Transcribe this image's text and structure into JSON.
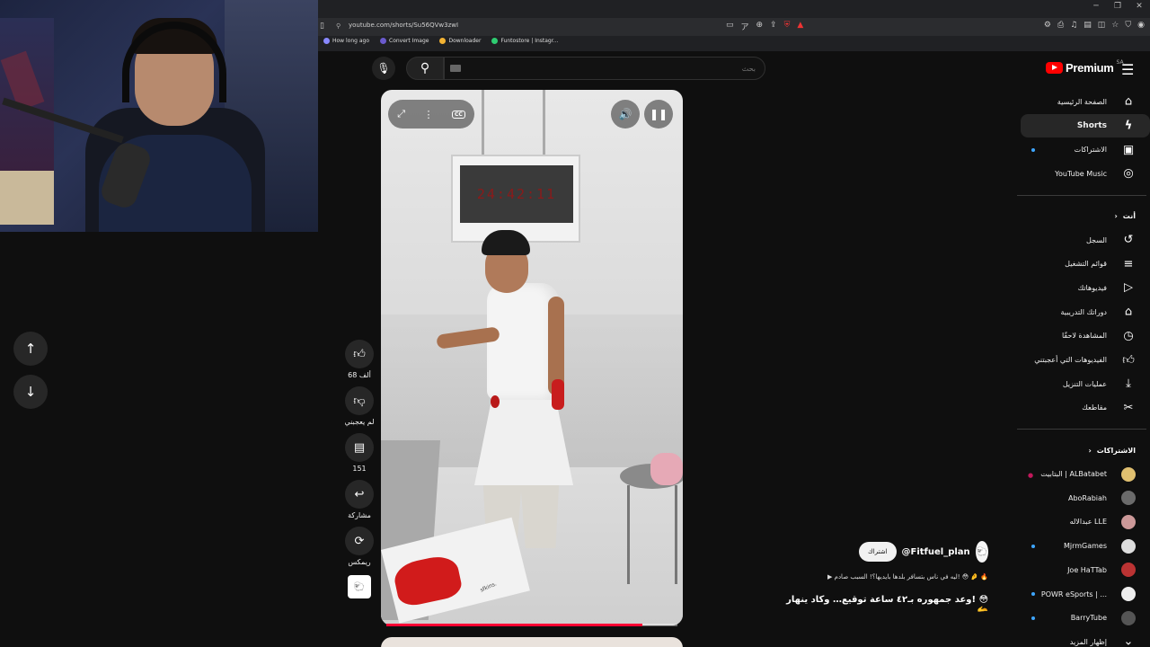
{
  "browser": {
    "url": "youtube.com/shorts/Su56QVw3zwI",
    "bookmarks": [
      {
        "label": "How long ago",
        "color": "#8888ff"
      },
      {
        "label": "Convert Image",
        "color": "#6a5acd"
      },
      {
        "label": "Downloader",
        "color": "#f2b233"
      },
      {
        "label": "Funtostore | Instagr...",
        "color": "#2ecc71"
      }
    ]
  },
  "header": {
    "logo_text": "Premium",
    "region": "SA",
    "search_placeholder": "بحث"
  },
  "video": {
    "timer_text": "24:42:11",
    "board_text": "sfkins.",
    "progress": 0.88,
    "accent": "#ff0033"
  },
  "actions": {
    "like_count": "68 ألف",
    "dislike_label": "لم يعجبني",
    "comments_count": "151",
    "share_label": "مشاركة",
    "remix_label": "ريمكس"
  },
  "channel": {
    "handle": "@Fitfuel_plan",
    "subscribe_label": "اشتراك",
    "description": "▶ ليه في ناس بتسافر بلدها بايديها؟! السبب صادم! 😳 🤌 🔥",
    "title": "وعد جمهوره بـ٤٢ ساعة توقيع… وكاد ينهار! 😳 🫴"
  },
  "sidebar": {
    "main": [
      {
        "label": "الصفحة الرئيسية",
        "icon": "home-icon"
      },
      {
        "label": "Shorts",
        "icon": "shorts-icon"
      },
      {
        "label": "الاشتراكات",
        "icon": "subscriptions-icon"
      },
      {
        "label": "YouTube Music",
        "icon": "music-icon"
      }
    ],
    "you_header": "أنت",
    "you": [
      {
        "label": "السجل",
        "icon": "history-icon"
      },
      {
        "label": "قوائم التشغيل",
        "icon": "playlist-icon"
      },
      {
        "label": "فيديوهاتك",
        "icon": "your-videos-icon"
      },
      {
        "label": "دوراتك التدريبية",
        "icon": "courses-icon"
      },
      {
        "label": "المشاهدة لاحقًا",
        "icon": "watch-later-icon"
      },
      {
        "label": "الفيديوهات التي أعجبتني",
        "icon": "liked-icon"
      },
      {
        "label": "عمليات التنزيل",
        "icon": "download-icon"
      },
      {
        "label": "مقاطعك",
        "icon": "clips-icon"
      }
    ],
    "subs_header": "الاشتراكات",
    "subs": [
      {
        "label": "البتابيت | ALBatabet",
        "color": "#e0c070",
        "live": true
      },
      {
        "label": "AboRabiah",
        "color": "#6b6b6b"
      },
      {
        "label": "عبدالاله LLE",
        "color": "#c99"
      },
      {
        "label": "MjrmGames",
        "color": "#ddd",
        "dot": true
      },
      {
        "label": "Joe HaTTab",
        "color": "#b33"
      },
      {
        "label": "POWR eSports | ...",
        "color": "#eee",
        "dot": true
      },
      {
        "label": "BarryTube",
        "color": "#555",
        "dot": true
      }
    ],
    "show_more": "إظهار المزيد"
  }
}
